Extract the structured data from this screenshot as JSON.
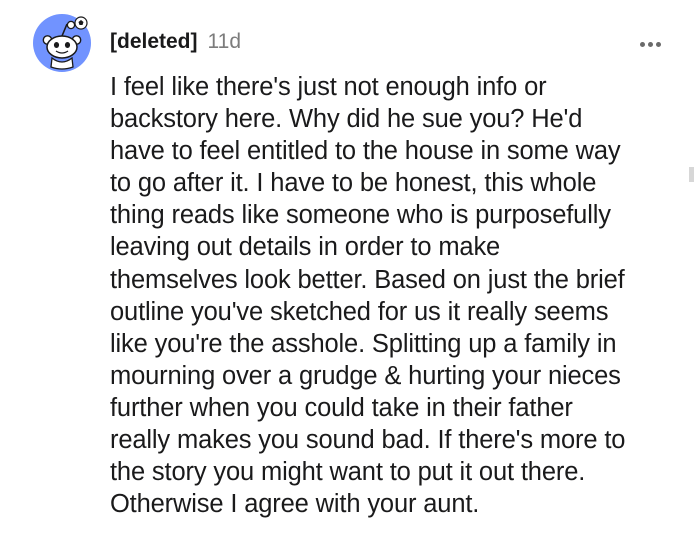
{
  "comment": {
    "username": "[deleted]",
    "timestamp": "11d",
    "avatar_icon": "reddit-snoo-avatar-icon",
    "more_icon": "more-options-icon",
    "body_lines": [
      "I feel like there's just not enough info or",
      "backstory here. Why did he sue you? He'd",
      "have to feel entitled to the house in some way",
      "to go after it. I have to be honest, this whole",
      "thing reads like someone who is purposefully",
      "leaving out details in order to make",
      "themselves look better. Based on just the brief",
      "outline you've sketched for us it really seems",
      "like you're the asshole. Splitting up a family in",
      "mourning over a grudge & hurting your nieces",
      "further when you could take in their father",
      "really makes you sound bad. If there's more to",
      "the story you might want to put it out there.",
      "Otherwise I agree with your aunt."
    ]
  },
  "colors": {
    "avatar_bg": "#7193ff",
    "text": "#1a1a1b",
    "meta": "#7c7c7c"
  }
}
